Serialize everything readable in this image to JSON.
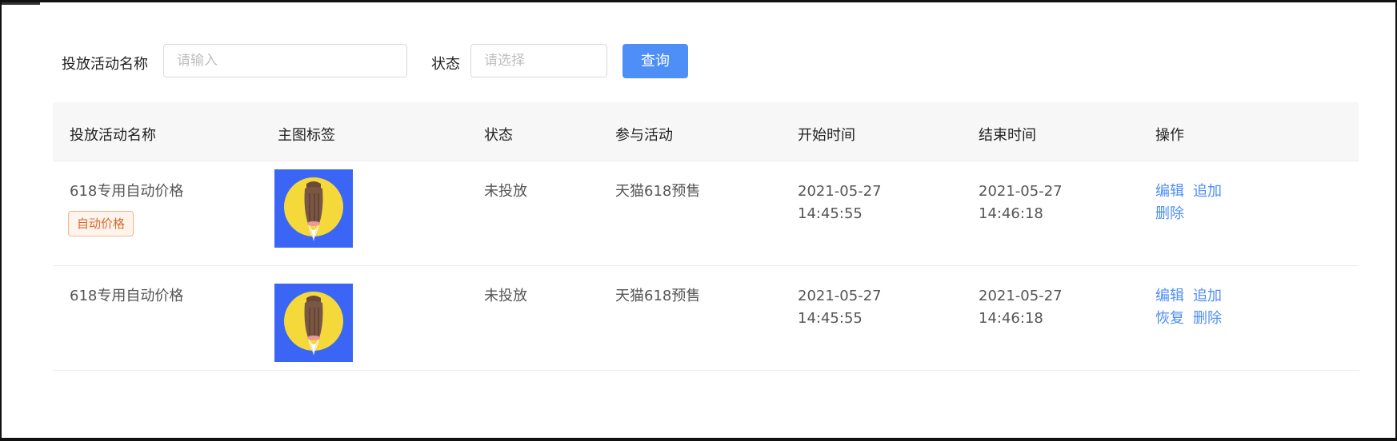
{
  "filter": {
    "name_label": "投放活动名称",
    "name_placeholder": "请输入",
    "status_label": "状态",
    "status_placeholder": "请选择",
    "query_button": "查询"
  },
  "table": {
    "columns": [
      "投放活动名称",
      "主图标签",
      "状态",
      "参与活动",
      "开始时间",
      "结束时间",
      "操作"
    ],
    "rows": [
      {
        "name": "618专用自动价格",
        "tag": "自动价格",
        "image": "fox-tail-moon-thumbnail",
        "status": "未投放",
        "activity": "天猫618预售",
        "start_date": "2021-05-27",
        "start_time": "14:45:55",
        "end_date": "2021-05-27",
        "end_time": "14:46:18",
        "actions": [
          "编辑",
          "追加",
          "删除"
        ]
      },
      {
        "name": "618专用自动价格",
        "tag": "",
        "image": "fox-tail-moon-thumbnail",
        "status": "未投放",
        "activity": "天猫618预售",
        "start_date": "2021-05-27",
        "start_time": "14:45:55",
        "end_date": "2021-05-27",
        "end_time": "14:46:18",
        "actions": [
          "编辑",
          "追加",
          "恢复",
          "删除"
        ]
      }
    ]
  },
  "colors": {
    "primary": "#4e8ef7",
    "tag_text": "#d9682c",
    "tag_bg": "#fff4ec",
    "thumb_bg": "#3b66f5",
    "thumb_moon": "#f5d93b"
  }
}
